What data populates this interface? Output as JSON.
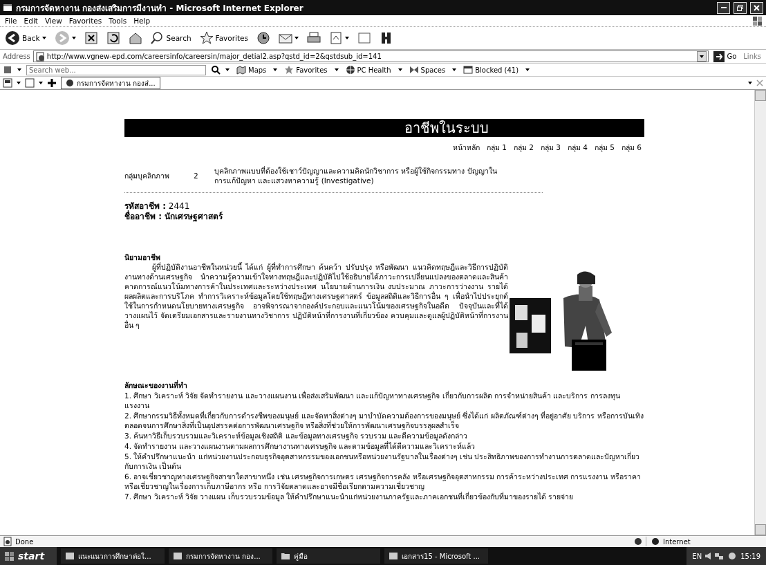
{
  "window": {
    "title": "กรมการจัดหางาน กองส่งเสริมการมีงานทำ - Microsoft Internet Explorer"
  },
  "menu": [
    "File",
    "Edit",
    "View",
    "Favorites",
    "Tools",
    "Help"
  ],
  "toolbar": {
    "back": "Back",
    "search": "Search",
    "favorites": "Favorites"
  },
  "address_bar": {
    "label": "Address",
    "url": "http://www.vgnew-epd.com/careersinfo/careersin/major_detial2.asp?qstd_id=2&qstdsub_id=141",
    "go": "Go",
    "links": "Links"
  },
  "links_bar": {
    "search_placeholder": "Search web...",
    "items": [
      "Maps",
      "Favorites",
      "PC Health",
      "Spaces",
      "Blocked (41)"
    ]
  },
  "tabs": [
    {
      "label": "กรมการจัดหางาน กองส่...",
      "selected": true
    }
  ],
  "page": {
    "heading": "อาชีพในระบบ",
    "nav": [
      "หน้าหลัก",
      "กลุ่ม 1",
      "กลุ่ม 2",
      "กลุ่ม 3",
      "กลุ่ม 4",
      "กลุ่ม 5",
      "กลุ่ม 6"
    ],
    "group": {
      "label": "กลุ่มบุคลิกภาพ",
      "number": "2",
      "description": "บุคลิกภาพแบบที่ต้องใช้เชาว์ปัญญาและความคิดนักวิชาการ หรือผู้ใช้กิจกรรมทาง ปัญญาในการแก้ปัญหา และแสวงหาความรู้ (Investigative)"
    },
    "career_code": "**รหัสอาชีพ :** 2441",
    "career_name": "ชื่ออาชีพ : นักเศรษฐศาสตร์",
    "definition_heading": "นิยามอาชีพ",
    "definition": "ผู้ที่ปฏิบัติงานอาชีพในหน่วยนี้ ได้แก่ ผู้ที่ทำการศึกษา ค้นคว้า ปรับปรุง หรือพัฒนา แนวคิดทฤษฎีและวิธีการปฏิบัติงานทางด้านเศรษฐกิจ นำความรู้ความเข้าใจทางทฤษฎีและปฏิบัติไปใช้อธิบายได้ภาวะการเปลี่ยนแปลงของตลาดและสินค้า คาดการณ์แนวโน้มทางการค้าในประเทศและระหว่างประเทศ นโยบายด้านการเงิน งบประมาณ ภาวะการว่างงาน รายได้ ผลผลิตและการบริโภค ทำการวิเคราะห์ข้อมูลโดยใช้ทฤษฎีทางเศรษฐศาสตร์ ข้อมูลสถิติและวิธีการอื่น ๆ เพื่อนำไปประยุกต์ใช้ในการกำหนดนโยบายทางเศรษฐกิจ อาจพิจารณาจากองค์ประกอบและแนวโน้มของเศรษฐกิจในอดีต ปัจจุบันและที่ได้วางแผนไว้ จัดเตรียมเอกสารและรายงานทางวิชาการ ปฏิบัติหน้าที่การงานที่เกี่ยวข้อง ควบคุมและดูแลผู้ปฏิบัติหน้าที่การงานอื่น ๆ",
    "duties_heading": "ลักษณะของงานที่ทำ",
    "duties": [
      "1. ศึกษา วิเคราะห์ วิจัย จัดทำรายงาน และวางแผนงาน เพื่อส่งเสริมพัฒนา และแก้ปัญหาทางเศรษฐกิจ เกี่ยวกับการผลิต การจำหน่ายสินค้า และบริการ การลงทุน แรงงาน",
      "2. ศึกษากรรมวิธีทั้งหมดที่เกี่ยวกับการดำรงชีพของมนุษย์ และจัดหาสิ่งต่างๆ มาบำบัดความต้องการของมนุษย์ ซึ่งได้แก่ ผลิตภัณฑ์ต่างๆ ที่อยู่อาศัย บริการ หรือการบันเทิง ตลอดจนการศึกษาสิ่งที่เป็นอุปสรรคต่อการพัฒนาเศรษฐกิจ หรือสิ่งที่ช่วยให้การพัฒนาเศรษฐกิจบรรลุผลสำเร็จ",
      "3. ค้นหาวิธีเก็บรวบรวมและวิเคราะห์ข้อมูลเชิงสถิติ และข้อมูลทางเศรษฐกิจ รวบรวม และตีความข้อมูลดังกล่าว",
      "4. จัดทำรายงาน และวางแผนงานตามผลการศึกษางานทางเศรษฐกิจ และตามข้อมูลที่ได้ตีความและวิเคราะห์แล้ว",
      "5. ให้คำปรึกษาแนะนำ แก่หน่วยงานประกอบธุรกิจอุตสาหกรรมของเอกชนหรือหน่วยงานรัฐบาลในเรื่องต่างๆ เช่น ประสิทธิภาพของการทำงานการตลาดและปัญหาเกี่ยวกับการเงิน เป็นต้น",
      "6. อาจเชี่ยวชาญทางเศรษฐกิจสาขาใดสาขาหนึ่ง เช่น เศรษฐกิจการเกษตร เศรษฐกิจการคลัง หรือเศรษฐกิจอุตสาหกรรม การค้าระหว่างประเทศ การแรงงาน หรือราคา หรือเชี่ยวชาญในเรื่องการเก็บภาษีอากร หรือ การวิจัยตลาดและอาจมีชื่อเรียกตามความเชี่ยวชาญ",
      "7. ศึกษา วิเคราะห์ วิจัย วางแผน เก็บรวบรวมข้อมูล ให้คำปรึกษาแนะนำแก่หน่วยงานภาครัฐและภาคเอกชนที่เกี่ยวข้องกับที่มาของรายได้ รายจ่าย"
    ]
  },
  "status_bar": {
    "status": "Done",
    "zone": "Internet"
  },
  "taskbar": {
    "start": "start",
    "tasks": [
      "แนะแนวการศึกษาต่อใ...",
      "กรมการจัดหางาน กอง...",
      "คู่มือ",
      "เอกสาร15 - Microsoft ..."
    ],
    "language": "EN",
    "clock": "15:19"
  }
}
